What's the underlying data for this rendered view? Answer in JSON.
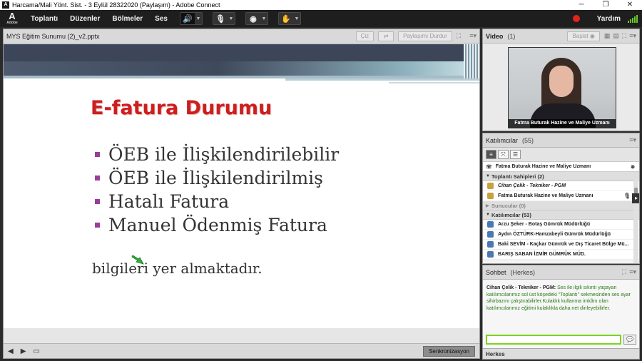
{
  "window": {
    "title": "Harcama/Mali Yönt. Sist. - 3 Eylül 28322020 (Paylaşım) - Adobe Connect",
    "controls": [
      "─",
      "❐",
      "✕"
    ]
  },
  "menubar": {
    "logo_text": "A",
    "logo_sub": "Adobe",
    "items": [
      "Toplantı",
      "Düzenler",
      "Bölmeler",
      "Ses"
    ],
    "help_label": "Yardım",
    "colors": {
      "accent": "#7cd321",
      "record": "#e3241b"
    }
  },
  "share_pod": {
    "title": "MYS Eğitim Sunumu (2)_v2.pptx",
    "buttons": {
      "draw": "Çiz",
      "stop_sharing": "Paylaşımı Durdur"
    },
    "slide": {
      "title": "E-fatura Durumu",
      "bullets": [
        "ÖEB ile İlişkilendirilebilir",
        "ÖEB ile İlişkilendirilmiş",
        "Hatalı Fatura",
        "Manuel Ödenmiş Fatura"
      ],
      "footer_text": "bilgileri yer almaktadır."
    },
    "sync_label": "Senkronizasyon"
  },
  "video_pod": {
    "title": "Video",
    "count": "(1)",
    "start_label": "Başlat",
    "caption": "Fatma Buturak Hazine ve Maliye Uzmanı"
  },
  "attendees_pod": {
    "title": "Katılımcılar",
    "count": "(55)",
    "active_speaker": "Fatma Buturak Hazine ve Maliye Uzmanı",
    "hosts_group": "Toplantı Sahipleri (2)",
    "hosts": [
      "Cihan Çelik - Tekniker - PGM",
      "Fatma Buturak Hazine ve Maliye Uzmanı"
    ],
    "presenters_group": "Sunucular (0)",
    "participants_group": "Katılımcılar (53)",
    "participants": [
      "Arzu Şeker - Botaş Gümrük Müdürlüğü",
      "Aydın ÖZTÜRK-Hamzabeyli Gümrük Müdürlüğü",
      "Baki SEVİM - Kaçkar Gümrük ve Dış Ticaret Bölge Mü...",
      "BARIŞ SABAN İZMİR GÜMRÜK MÜD."
    ]
  },
  "chat_pod": {
    "title": "Sohbet",
    "audience": "(Herkes)",
    "message_author": "Cihan Çelik - Tekniker - PGM:",
    "message_text": "Ses ile ilgili sıkıntı yaşayan katılımcılarımız sol üst köşedeki \"Toplantı\" sekmesinden ses ayar sihirbazını çalıştırabilirler.Kulaklık kullanma imkânı olan katılımcılarımız eğitimi kulaklıkla daha net dinleyebilirler.",
    "tab_label": "Herkes"
  }
}
